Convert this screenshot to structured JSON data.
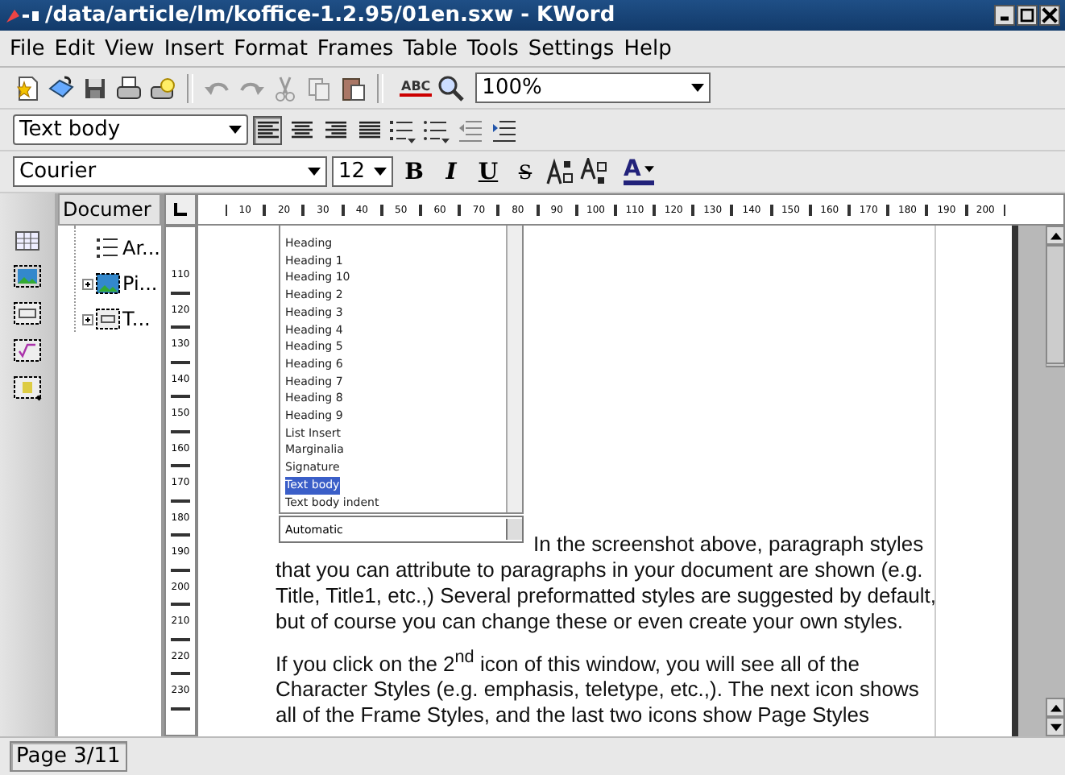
{
  "window": {
    "title": "/data/article/lm/koffice-1.2.95/01en.sxw - KWord"
  },
  "menu": [
    {
      "label": "File"
    },
    {
      "label": "Edit"
    },
    {
      "label": "View"
    },
    {
      "label": "Insert"
    },
    {
      "label": "Format"
    },
    {
      "label": "Frames"
    },
    {
      "label": "Table"
    },
    {
      "label": "Tools"
    },
    {
      "label": "Settings"
    },
    {
      "label": "Help"
    }
  ],
  "toolbar": {
    "spell_label": "ABC",
    "zoom": "100%"
  },
  "format_bar": {
    "style": "Text body",
    "align_buttons": [
      {
        "selected": true
      },
      {
        "selected": false
      },
      {
        "selected": false
      },
      {
        "selected": false
      }
    ]
  },
  "font_bar": {
    "font": "Courier",
    "size": "12",
    "buttons": [
      {
        "label": "B",
        "kind": "bold"
      },
      {
        "label": "I",
        "kind": "italic"
      },
      {
        "label": "U",
        "kind": "underline"
      },
      {
        "label": "S",
        "kind": "strike"
      }
    ],
    "color_label": "A"
  },
  "doc_panel": {
    "tab": "Documer",
    "items": [
      {
        "label": "Ar...",
        "kind": "text",
        "expandable": false
      },
      {
        "label": "Pi...",
        "kind": "picture",
        "expandable": true
      },
      {
        "label": "T...",
        "kind": "table",
        "expandable": true
      }
    ]
  },
  "h_ruler": [
    "10",
    "20",
    "30",
    "40",
    "50",
    "60",
    "70",
    "80",
    "90",
    "100",
    "110",
    "120",
    "130",
    "140",
    "150",
    "160",
    "170",
    "180",
    "190",
    "200"
  ],
  "v_ruler": [
    "110",
    "120",
    "130",
    "140",
    "150",
    "160",
    "170",
    "180",
    "190",
    "200",
    "210",
    "220",
    "230"
  ],
  "embedded_list": {
    "items": [
      {
        "label": "Heading",
        "selected": false
      },
      {
        "label": "Heading 1",
        "selected": false
      },
      {
        "label": "Heading 10",
        "selected": false
      },
      {
        "label": "Heading 2",
        "selected": false
      },
      {
        "label": "Heading 3",
        "selected": false
      },
      {
        "label": "Heading 4",
        "selected": false
      },
      {
        "label": "Heading 5",
        "selected": false
      },
      {
        "label": "Heading 6",
        "selected": false
      },
      {
        "label": "Heading 7",
        "selected": false
      },
      {
        "label": "Heading 8",
        "selected": false
      },
      {
        "label": "Heading 9",
        "selected": false
      },
      {
        "label": "List Insert",
        "selected": false
      },
      {
        "label": "Marginalia",
        "selected": false
      },
      {
        "label": "Signature",
        "selected": false
      },
      {
        "label": "Text body",
        "selected": true
      },
      {
        "label": "Text body indent",
        "selected": false
      }
    ],
    "dropdown": "Automatic"
  },
  "paragraphs": [
    "In the screenshot above, paragraph styles that you can attribute to paragraphs in your document are shown (e.g. Title, Title1, etc.,) Several preformatted styles are suggested by default, but of course you can change these or even create your own styles.",
    "If you click on the 2$^{nd}$ icon of this window, you will see all of the Character Styles (e.g. emphasis, teletype, etc.,). The next icon shows all of the Frame Styles, and the last two icons show Page Styles"
  ],
  "status_bar": {
    "page": "Page 3/11"
  }
}
